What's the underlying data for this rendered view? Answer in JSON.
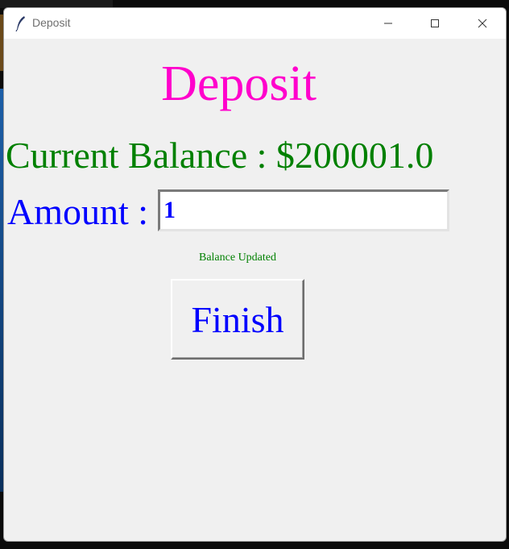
{
  "window": {
    "title": "Deposit",
    "icon": "feather-icon",
    "controls": [
      "minimize-icon",
      "maximize-icon",
      "close-icon"
    ]
  },
  "content": {
    "heading": "Deposit",
    "balance_text": "Current Balance : $200001.0",
    "amount_label": "Amount :",
    "amount_value": "1",
    "status_text": "Balance Updated",
    "finish_label": "Finish"
  },
  "colors": {
    "heading": "#ff00cc",
    "balance": "#008000",
    "amount": "#0000ff",
    "status": "#008000",
    "button_text": "#0000ff",
    "window_bg": "#f0f0f0"
  }
}
